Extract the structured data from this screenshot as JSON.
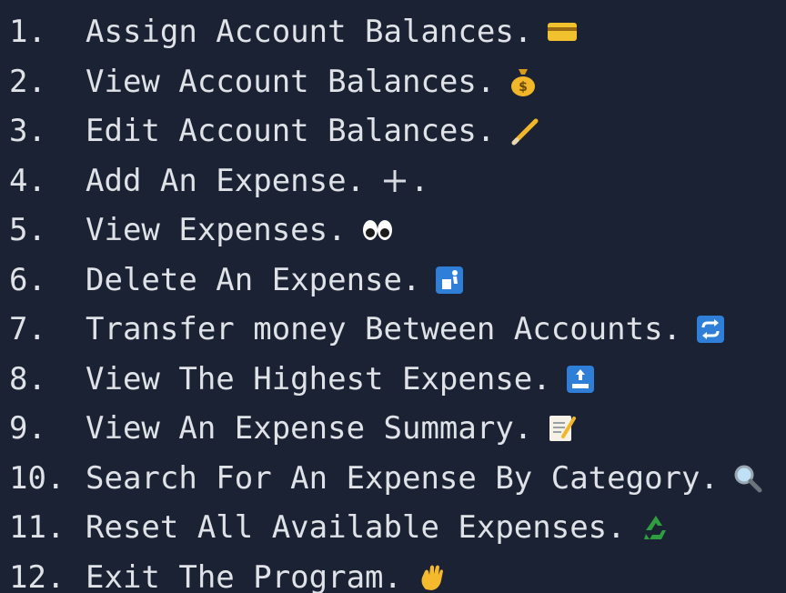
{
  "menu": {
    "items": [
      {
        "number": "1.",
        "label": "Assign Account Balances.",
        "icon": "credit-card-icon"
      },
      {
        "number": "2.",
        "label": "View Account Balances.",
        "icon": "money-bag-icon"
      },
      {
        "number": "3.",
        "label": "Edit Account Balances.",
        "icon": "pencil-icon"
      },
      {
        "number": "4.",
        "label": "Add An Expense.",
        "icon": "plus-icon"
      },
      {
        "number": "5.",
        "label": "View Expenses.",
        "icon": "eyes-icon"
      },
      {
        "number": "6.",
        "label": "Delete An Expense.",
        "icon": "trash-sign-icon"
      },
      {
        "number": "7.",
        "label": "Transfer money Between Accounts.",
        "icon": "repeat-icon"
      },
      {
        "number": "8.",
        "label": "View The Highest Expense.",
        "icon": "top-arrow-icon"
      },
      {
        "number": "9.",
        "label": "View An Expense Summary.",
        "icon": "memo-icon"
      },
      {
        "number": "10.",
        "label": "Search For An Expense By Category.",
        "icon": "magnifier-icon"
      },
      {
        "number": "11.",
        "label": "Reset All Available Expenses.",
        "icon": "recycle-icon"
      },
      {
        "number": "12.",
        "label": "Exit The Program.",
        "icon": "waving-hand-icon"
      }
    ],
    "plus_suffix": "."
  },
  "colors": {
    "background": "#1b2233",
    "text": "#dfe3e8",
    "emoji_blue": "#2f7fd8",
    "emoji_yellow": "#f2c12e",
    "emoji_green": "#2e9e3e"
  }
}
